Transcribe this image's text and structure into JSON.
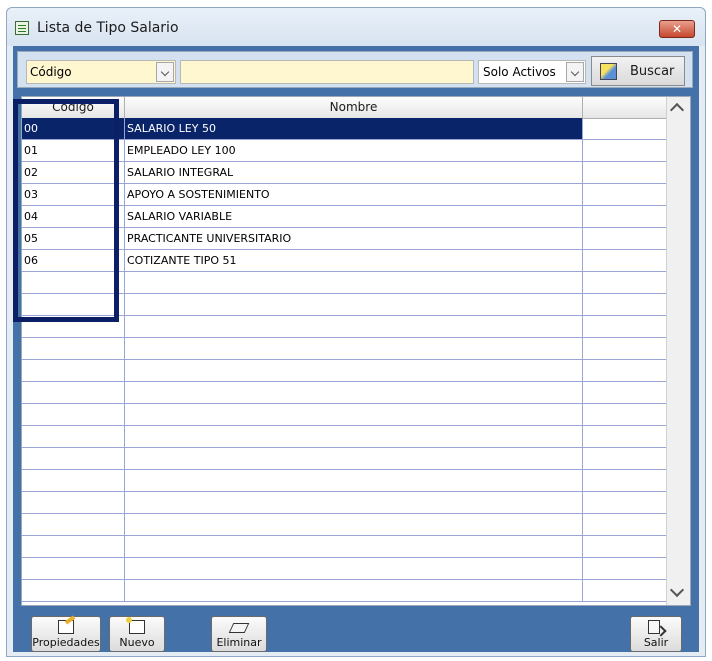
{
  "window": {
    "title": "Lista de Tipo Salario"
  },
  "toolbar": {
    "field_selected": "Código",
    "search_value": "",
    "status_selected": "Solo Activos",
    "buscar_label": "Buscar"
  },
  "grid": {
    "columns": [
      "Código",
      "Nombre",
      ""
    ],
    "rows": [
      {
        "codigo": "00",
        "nombre": "SALARIO LEY 50",
        "selected": true
      },
      {
        "codigo": "01",
        "nombre": "EMPLEADO LEY 100"
      },
      {
        "codigo": "02",
        "nombre": "SALARIO INTEGRAL"
      },
      {
        "codigo": "03",
        "nombre": "APOYO A SOSTENIMIENTO"
      },
      {
        "codigo": "04",
        "nombre": "SALARIO VARIABLE"
      },
      {
        "codigo": "05",
        "nombre": "PRACTICANTE UNIVERSITARIO"
      },
      {
        "codigo": "06",
        "nombre": "COTIZANTE TIPO 51"
      }
    ],
    "empty_rows": 15
  },
  "actions": {
    "propiedades": "Propiedades",
    "nuevo": "Nuevo",
    "eliminar": "Eliminar",
    "salir": "Salir"
  },
  "colors": {
    "selection": "#0a246a",
    "highlight_box": "#0b1f66",
    "panel": "#4472a8",
    "field_bg": "#fff7d0"
  },
  "icons": [
    "app-list-icon",
    "close-icon",
    "chevron-down-icon",
    "search-binoculars-icon",
    "properties-icon",
    "new-document-icon",
    "eraser-icon",
    "exit-door-icon",
    "scroll-up-icon",
    "scroll-down-icon"
  ]
}
